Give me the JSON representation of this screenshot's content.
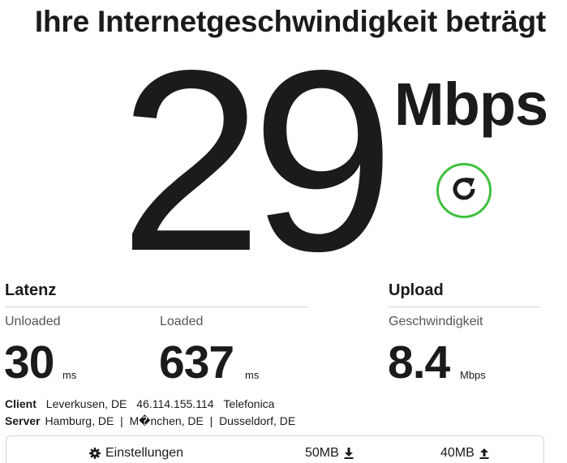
{
  "headline": "Ihre Internetgeschwindigkeit beträgt",
  "download": {
    "value": "29",
    "units": "Mbps"
  },
  "latency": {
    "title": "Latenz",
    "unloaded_label": "Unloaded",
    "unloaded_value": "30",
    "unloaded_unit": "ms",
    "loaded_label": "Loaded",
    "loaded_value": "637",
    "loaded_unit": "ms"
  },
  "upload": {
    "title": "Upload",
    "label": "Geschwindigkeit",
    "value": "8.4",
    "unit": "Mbps"
  },
  "client": {
    "label": "Client",
    "location": "Leverkusen, DE",
    "ip": "46.114.155.114",
    "isp": "Telefonica"
  },
  "server": {
    "label": "Server",
    "locations": "Hamburg, DE  |  M�nchen, DE  |  Dusseldorf, DE"
  },
  "settings": {
    "label": "Einstellungen",
    "download_size": "50MB",
    "upload_size": "40MB"
  },
  "colors": {
    "accent_green": "#3ec03e",
    "text": "#1b1b1b",
    "muted": "#555555"
  },
  "icons": {
    "refresh": "refresh-icon",
    "settings": "gear-icon",
    "download": "download-arrow-icon",
    "upload": "upload-arrow-icon"
  }
}
